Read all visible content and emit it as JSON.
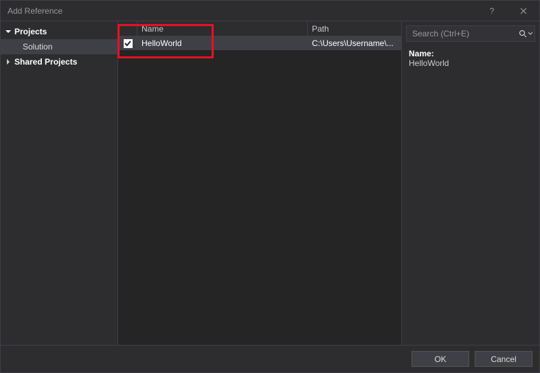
{
  "window": {
    "title": "Add Reference"
  },
  "sidebar": {
    "projects_label": "Projects",
    "solution_label": "Solution",
    "shared_projects_label": "Shared Projects"
  },
  "grid": {
    "header_name": "Name",
    "header_path": "Path",
    "rows": [
      {
        "name": "HelloWorld",
        "path": "C:\\Users\\Username\\...",
        "checked": true
      }
    ]
  },
  "search": {
    "placeholder": "Search (Ctrl+E)"
  },
  "details": {
    "name_label": "Name:",
    "name_value": "HelloWorld"
  },
  "buttons": {
    "ok": "OK",
    "cancel": "Cancel"
  }
}
